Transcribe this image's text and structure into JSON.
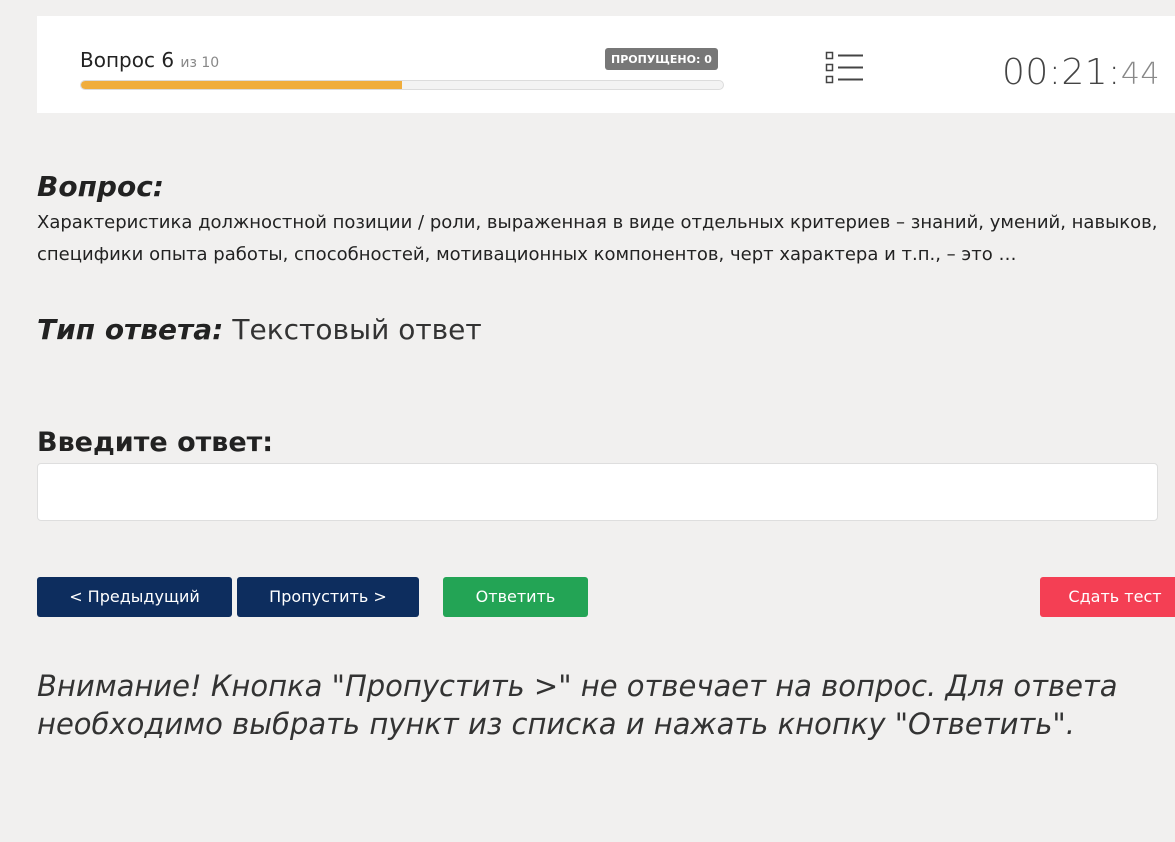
{
  "header": {
    "question_word": "Вопрос 6",
    "question_of": "из 10",
    "progress_fraction": 0.5,
    "skipped_label": "ПРОПУЩЕНО: 0",
    "list_icon": "question-list-icon",
    "timer_main": "00:21:",
    "timer_seconds": "44",
    "progress_color": "#f0ad3c"
  },
  "question": {
    "heading": "Вопрос:",
    "line1": "Характеристика должностной позиции / роли, выраженная в виде отдельных критериев – знаний, умений, навыков,",
    "line2": "специфики опыта работы, способностей, мотивационных компонентов, черт характера и т.п., – это …"
  },
  "answer_type": {
    "label": "Тип ответа:",
    "value": "Текстовый ответ"
  },
  "answer_input": {
    "label": "Введите ответ:",
    "value": "",
    "placeholder": ""
  },
  "buttons": {
    "prev_label": "< Предыдущий",
    "skip_label": "Пропустить >",
    "answer_label": "Ответить",
    "submit_label": "Сдать тест",
    "nav_color": "#0d2d5e",
    "answer_color": "#23a455",
    "submit_color": "#f43f54"
  },
  "warning": {
    "line1": "Внимание! Кнопка \"Пропустить >\" не отвечает на вопрос. Для ответа",
    "line2": "необходимо выбрать пункт из списка и нажать кнопку \"Ответить\"."
  }
}
